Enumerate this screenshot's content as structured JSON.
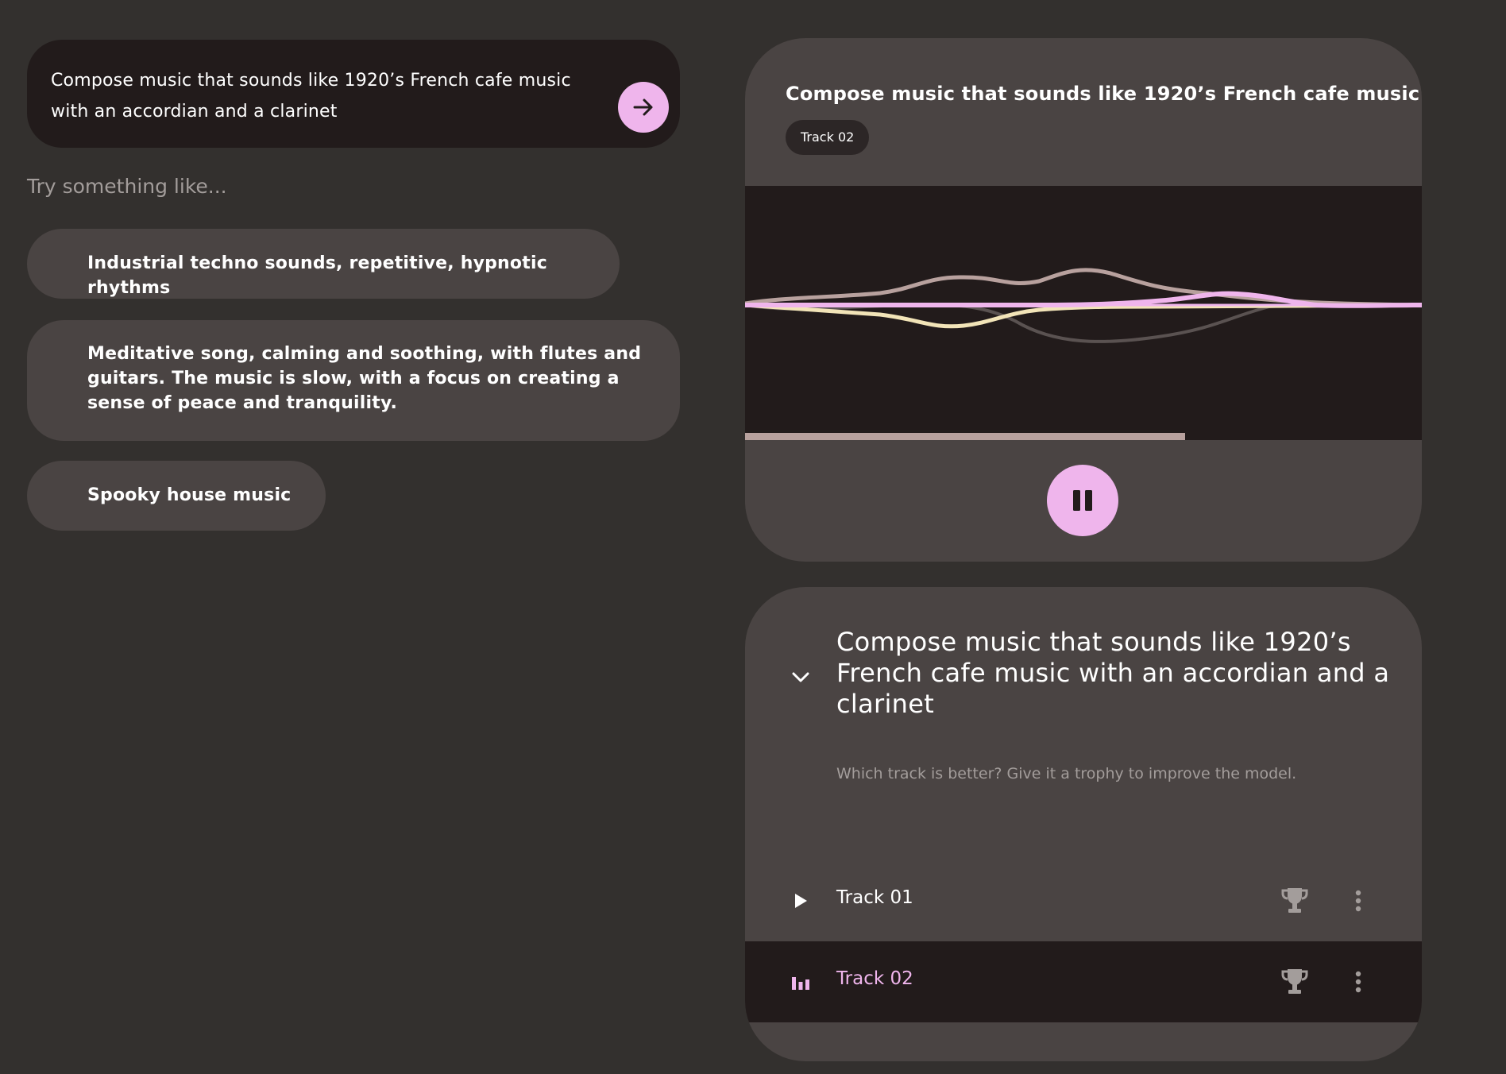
{
  "prompt": {
    "text": "Compose music that sounds like 1920’s French cafe music with an accordian and a clarinet",
    "submit_icon": "arrow-right-icon"
  },
  "suggestions": {
    "label": "Try something like...",
    "items": [
      "Industrial techno sounds, repetitive, hypnotic rhythms",
      "Meditative song, calming and soothing, with flutes and guitars. The music is slow, with a focus on creating a sense of peace and tranquility.",
      "Spooky house music"
    ]
  },
  "player": {
    "title": "Compose music that sounds like 1920’s French cafe music ...",
    "track_chip": "Track 02",
    "progress_fraction": 0.65,
    "play_state_icon": "pause-icon"
  },
  "tracks": {
    "heading": "Compose music that sounds like 1920’s French cafe music with an accordian and a clarinet",
    "hint": "Which track is better? Give it a trophy to improve the model.",
    "items": [
      {
        "label": "Track 01",
        "state_icon": "play-icon",
        "active": false
      },
      {
        "label": "Track 02",
        "state_icon": "equalizer-icon",
        "active": true
      }
    ]
  },
  "colors": {
    "background": "#33302e",
    "card": "#4a4443",
    "dark": "#221b1b",
    "accent": "#efb5ec",
    "muted_text": "#a39d9b"
  }
}
